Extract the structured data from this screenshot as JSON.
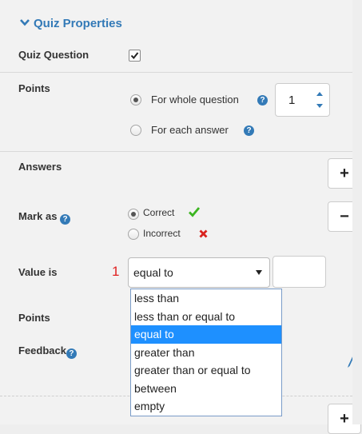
{
  "header": {
    "title": "Quiz Properties"
  },
  "quiz_question": {
    "label": "Quiz Question",
    "checked": true
  },
  "points": {
    "label": "Points",
    "option_whole": "For whole question",
    "option_each": "For each answer",
    "selected": "For whole question",
    "value": "1"
  },
  "answers": {
    "label": "Answers",
    "add_button": "+",
    "remove_button": "−"
  },
  "mark_as": {
    "label": "Mark as",
    "correct": "Correct",
    "incorrect": "Incorrect",
    "selected": "Correct"
  },
  "value_is": {
    "label": "Value is",
    "marker": "1",
    "selected": "equal to",
    "value": "",
    "options": [
      "less than",
      "less than or equal to",
      "equal to",
      "greater than",
      "greater than or equal to",
      "between",
      "empty"
    ]
  },
  "points2": {
    "label": "Points"
  },
  "feedback": {
    "label": "Feedback"
  },
  "footer": {
    "add_button": "+"
  },
  "colors": {
    "accent": "#337ab7",
    "correct": "#3cb521",
    "incorrect": "#d9231f",
    "marker": "#e02020",
    "selected_option": "#1e90ff"
  }
}
